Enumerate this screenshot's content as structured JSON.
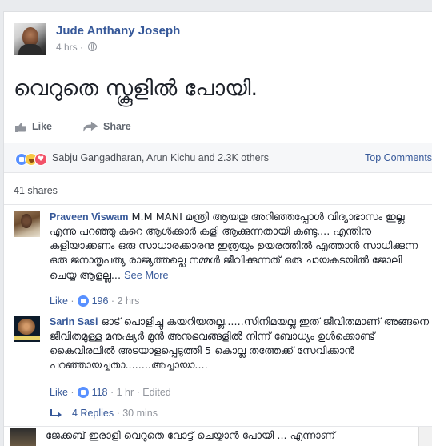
{
  "post": {
    "author": "Jude Anthany Joseph",
    "time": "4 hrs",
    "privacy_icon": "globe-icon",
    "text": "വെറുതെ സ്കൂളിൽ പോയി.",
    "like_label": "Like",
    "share_label": "Share"
  },
  "reactions": {
    "icons": [
      "like-reaction-icon",
      "haha-reaction-icon",
      "love-reaction-icon"
    ],
    "names": "Sabju Gangadharan, Arun Kichu and 2.3K others",
    "sort_label": "Top Comments"
  },
  "shares": "41 shares",
  "comments": [
    {
      "author": "Praveen Viswam",
      "text": " M.M MANI മന്ത്രി ആയതു അറിഞ്ഞപ്പോൾ വിദ്യാഭാസം ഇല്ല എന്നു പറഞ്ഞു കുറെ ആൾക്കാർ കളി ആക്കുന്നതായി കണ്ടു.... എന്തിനു കളിയാക്കണം ഒരു സാധാരക്കാരനു ഇത്രയും ഉയരത്തിൽ എത്താൻ സാധിക്കുന്ന ഒരു ജനാതൃപത്യ രാജ്യത്തല്ലെ നമ്മൾ ജീവിക്കുന്നത് ഒരു ചായകടയിൽ ജോലി ചെയ്യ ആളല്ല... ",
      "see_more": "See More",
      "like_label": "Like",
      "likes": "196",
      "time": "2 hrs"
    },
    {
      "author": "Sarin Sasi",
      "text": " ഓട് പൊളിച്ചു കയറിയതല്ല......സിനിമയല്ല ഇത് ജീവിതമാണ് അങ്ങനെ ജീവിതമുള്ള മനുഷ്യർ മുൻ അനുഭവങ്ങളിൽ നിന്ന് ബോധ്യം ഉൾക്കൊണ്ട് കൈവിരലിൽ അടയാളപ്പെടുത്തി 5 കൊല്ല തത്തേക്ക് സേവിക്കാൻ പറഞ്ഞായച്ചതാ........അച്ചായാ....",
      "like_label": "Like",
      "likes": "118",
      "time": "1 hr",
      "edited": "Edited"
    }
  ],
  "replies": {
    "label": "4 Replies",
    "time": "30 mins"
  },
  "partial_comment": "ജേക്കബ് ഇരാളി വെറുതെ വോട്ട് ചെയ്യാൻ പോയി ... എന്നാണ്"
}
